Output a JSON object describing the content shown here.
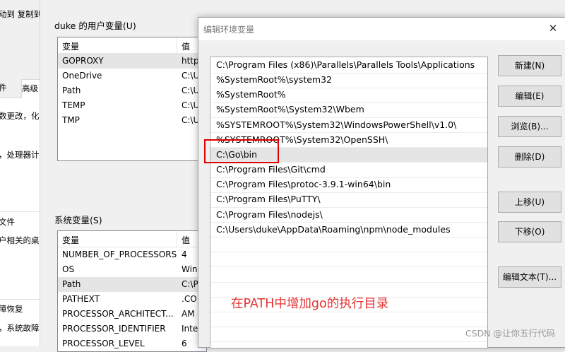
{
  "left_strip": {
    "toolbar_text": "动到 复制到",
    "tab1": "件",
    "tab2": "高级",
    "line1": "数更改，化",
    "line2": "，处理器计",
    "line3": "文件",
    "line4": "户相关的桌",
    "line5": "障恢复",
    "line6": "，系统故障"
  },
  "env_window": {
    "user_vars_title": "duke 的用户变量(U)",
    "sys_vars_title": "系统变量(S)",
    "col_variable": "变量",
    "col_value": "值",
    "user_vars": [
      {
        "name": "GOPROXY",
        "value": "http",
        "selected": true
      },
      {
        "name": "OneDrive",
        "value": "C:\\U",
        "selected": false
      },
      {
        "name": "Path",
        "value": "C:\\U",
        "selected": false
      },
      {
        "name": "TEMP",
        "value": "C:\\U",
        "selected": false
      },
      {
        "name": "TMP",
        "value": "C:\\U",
        "selected": false
      }
    ],
    "sys_vars": [
      {
        "name": "NUMBER_OF_PROCESSORS",
        "value": "4",
        "selected": false
      },
      {
        "name": "OS",
        "value": "Win",
        "selected": false
      },
      {
        "name": "Path",
        "value": "C:\\P",
        "selected": true
      },
      {
        "name": "PATHEXT",
        "value": ".CO",
        "selected": false
      },
      {
        "name": "PROCESSOR_ARCHITECT...",
        "value": "AM",
        "selected": false
      },
      {
        "name": "PROCESSOR_IDENTIFIER",
        "value": "Inte",
        "selected": false
      },
      {
        "name": "PROCESSOR_LEVEL",
        "value": "6",
        "selected": false
      }
    ]
  },
  "edit_dialog": {
    "title": "编辑环境变量",
    "close_glyph": "✕",
    "paths": [
      "C:\\Program Files (x86)\\Parallels\\Parallels Tools\\Applications",
      "%SystemRoot%\\system32",
      "%SystemRoot%",
      "%SystemRoot%\\System32\\Wbem",
      "%SYSTEMROOT%\\System32\\WindowsPowerShell\\v1.0\\",
      "%SYSTEMROOT%\\System32\\OpenSSH\\",
      "C:\\Go\\bin",
      "C:\\Program Files\\Git\\cmd",
      "C:\\Program Files\\protoc-3.9.1-win64\\bin",
      "C:\\Program Files\\PuTTY\\",
      "C:\\Program Files\\nodejs\\",
      "C:\\Users\\duke\\AppData\\Roaming\\npm\\node_modules"
    ],
    "selected_path_index": 6,
    "buttons": {
      "new": "新建(N)",
      "edit": "编辑(E)",
      "browse": "浏览(B)...",
      "delete": "删除(D)",
      "move_up": "上移(U)",
      "move_down": "下移(O)",
      "edit_text": "编辑文本(T)..."
    },
    "annotation": "在PATH中增加go的执行目录",
    "highlight_color": "#e00000"
  },
  "watermark": "CSDN @让你五行代码"
}
